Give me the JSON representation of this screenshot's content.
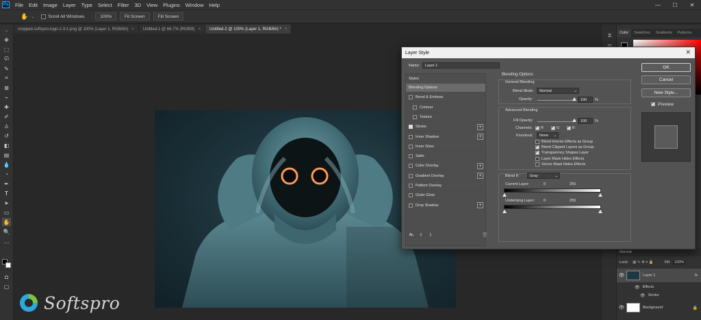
{
  "menu": {
    "logo": "Ps",
    "items": [
      "File",
      "Edit",
      "Image",
      "Layer",
      "Type",
      "Select",
      "Filter",
      "3D",
      "View",
      "Plugins",
      "Window",
      "Help"
    ]
  },
  "window_controls": {
    "minimize": "—",
    "maximize": "☐",
    "close": "✕"
  },
  "options_bar": {
    "scroll_all_windows": "Scroll All Windows",
    "zoom_100": "100%",
    "fit_screen": "Fit Screen",
    "fill_screen": "Fill Screen"
  },
  "tabs": [
    {
      "label": "cropped-softspro-logo-1-3-1.png @ 100% (Layer 1, RGB/8#)",
      "close": "×"
    },
    {
      "label": "Untitled-1 @ 66.7% (RGB/8)",
      "close": "×"
    },
    {
      "label": "Untitled-2 @ 100% (Layer 1, RGB/8#) *",
      "close": "×"
    }
  ],
  "right_panel": {
    "tabs": [
      "Color",
      "Swatches",
      "Gradients",
      "Patterns"
    ],
    "layers": {
      "mode": "Normal",
      "lock_label": "Lock:",
      "fill_label": "Fill:",
      "fill_value": "100%",
      "items": [
        {
          "name": "Layer 1"
        },
        {
          "name": "Effects"
        },
        {
          "name": "Stroke"
        },
        {
          "name": "Background"
        }
      ]
    }
  },
  "dialog": {
    "title": "Layer Style",
    "close": "✕",
    "name_label": "Name:",
    "name_value": "Layer 1",
    "styles_header": "Styles",
    "styles": [
      {
        "label": "Blending Options",
        "selected": true,
        "checkbox": false,
        "plus": false,
        "indent": 0
      },
      {
        "label": "Bevel & Emboss",
        "selected": false,
        "checkbox": true,
        "checked": false,
        "plus": false,
        "indent": 0
      },
      {
        "label": "Contour",
        "selected": false,
        "checkbox": true,
        "checked": false,
        "plus": false,
        "indent": 1
      },
      {
        "label": "Texture",
        "selected": false,
        "checkbox": true,
        "checked": false,
        "plus": false,
        "indent": 1
      },
      {
        "label": "Stroke",
        "selected": false,
        "checkbox": true,
        "checked": true,
        "plus": true,
        "indent": 0
      },
      {
        "label": "Inner Shadow",
        "selected": false,
        "checkbox": true,
        "checked": false,
        "plus": true,
        "indent": 0
      },
      {
        "label": "Inner Glow",
        "selected": false,
        "checkbox": true,
        "checked": false,
        "plus": false,
        "indent": 0
      },
      {
        "label": "Satin",
        "selected": false,
        "checkbox": true,
        "checked": false,
        "plus": false,
        "indent": 0
      },
      {
        "label": "Color Overlay",
        "selected": false,
        "checkbox": true,
        "checked": false,
        "plus": true,
        "indent": 0
      },
      {
        "label": "Gradient Overlay",
        "selected": false,
        "checkbox": true,
        "checked": false,
        "plus": true,
        "indent": 0
      },
      {
        "label": "Pattern Overlay",
        "selected": false,
        "checkbox": true,
        "checked": false,
        "plus": false,
        "indent": 0
      },
      {
        "label": "Outer Glow",
        "selected": false,
        "checkbox": true,
        "checked": false,
        "plus": false,
        "indent": 0
      },
      {
        "label": "Drop Shadow",
        "selected": false,
        "checkbox": true,
        "checked": false,
        "plus": true,
        "indent": 0
      }
    ],
    "footer_fx": "fx.",
    "blending_options": "Blending Options",
    "general_blending": "General Blending",
    "blend_mode_label": "Blend Mode:",
    "blend_mode_value": "Normal",
    "opacity_label": "Opacity:",
    "opacity_value": "100",
    "percent": "%",
    "advanced_blending": "Advanced Blending",
    "fill_opacity_label": "Fill Opacity:",
    "fill_opacity_value": "100",
    "channels_label": "Channels:",
    "channel_r": "R",
    "channel_g": "G",
    "channel_b": "B",
    "knockout_label": "Knockout:",
    "knockout_value": "None",
    "adv_options": [
      {
        "label": "Blend Interior Effects as Group",
        "checked": false
      },
      {
        "label": "Blend Clipped Layers as Group",
        "checked": true
      },
      {
        "label": "Transparency Shapes Layer",
        "checked": true
      },
      {
        "label": "Layer Mask Hides Effects",
        "checked": false
      },
      {
        "label": "Vector Mask Hides Effects",
        "checked": false
      }
    ],
    "blend_if_label": "Blend If:",
    "blend_if_value": "Gray",
    "current_layer_label": "Current Layer:",
    "underlying_layer_label": "Underlying Layer:",
    "range_min": "0",
    "range_max": "255",
    "buttons": {
      "ok": "OK",
      "cancel": "Cancel",
      "new_style": "New Style..."
    },
    "preview_label": "Preview"
  },
  "watermark": {
    "text": "Softspro"
  },
  "colors": {
    "accent": "#31a8ff",
    "workspace": "#282828",
    "panel": "#323232",
    "dialog": "#535353"
  }
}
